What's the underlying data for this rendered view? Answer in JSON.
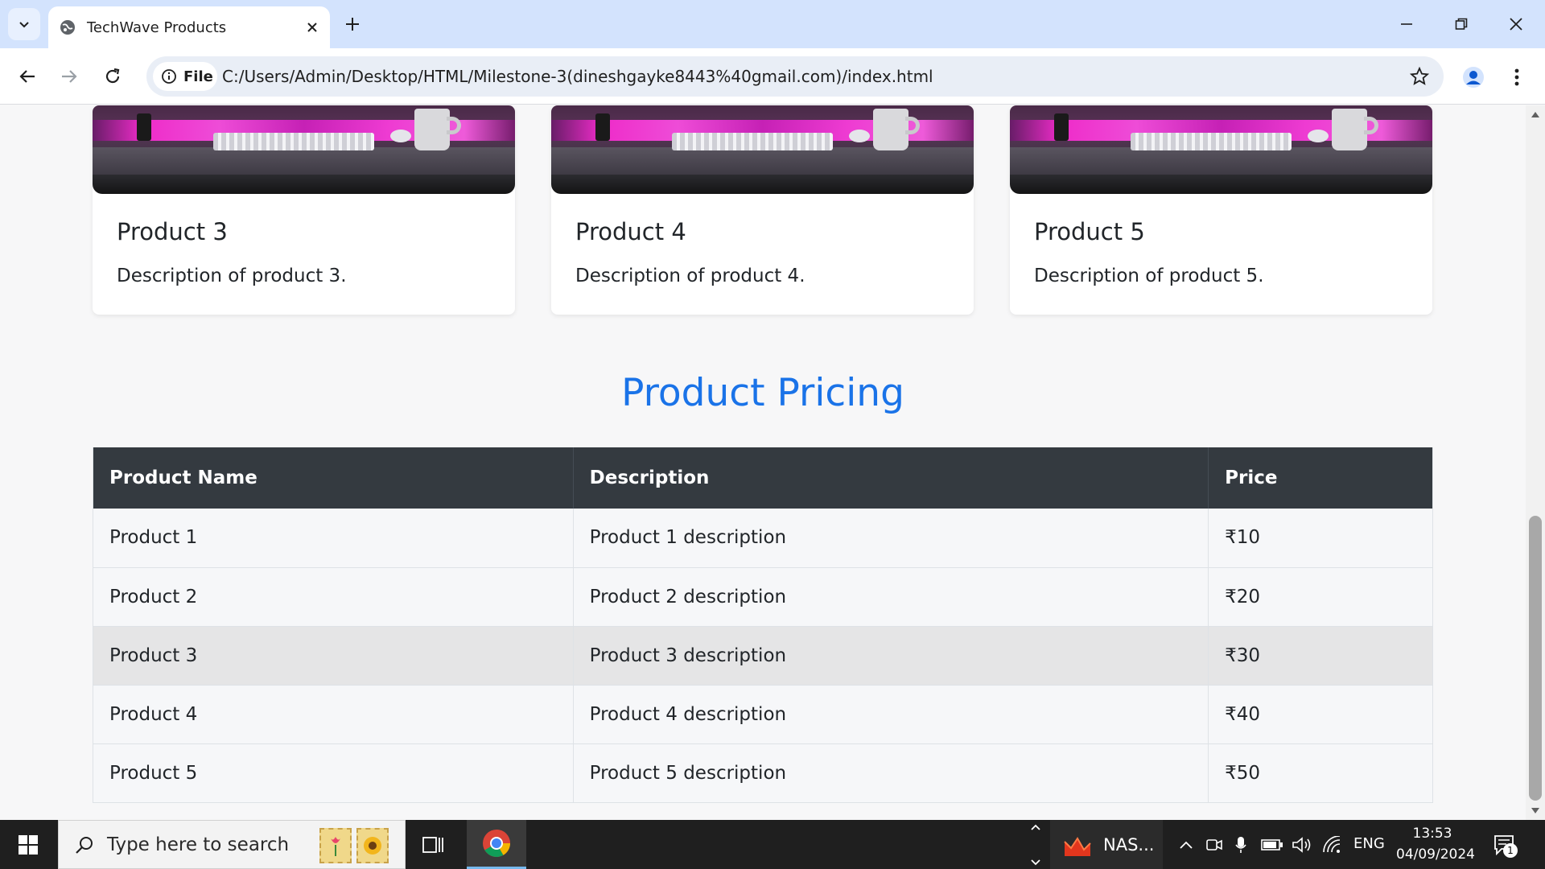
{
  "browser": {
    "tab_title": "TechWave Products",
    "file_chip_label": "File",
    "url": "C:/Users/Admin/Desktop/HTML/Milestone-3(dineshgayke8443%40gmail.com)/index.html"
  },
  "page": {
    "cards": [
      {
        "title": "Product 3",
        "description": "Description of product 3."
      },
      {
        "title": "Product 4",
        "description": "Description of product 4."
      },
      {
        "title": "Product 5",
        "description": "Description of product 5."
      }
    ],
    "pricing_title": "Product Pricing",
    "table": {
      "headers": [
        "Product Name",
        "Description",
        "Price"
      ],
      "rows": [
        [
          "Product 1",
          "Product 1 description",
          "₹10"
        ],
        [
          "Product 2",
          "Product 2 description",
          "₹20"
        ],
        [
          "Product 3",
          "Product 3 description",
          "₹30"
        ],
        [
          "Product 4",
          "Product 4 description",
          "₹40"
        ],
        [
          "Product 5",
          "Product 5 description",
          "₹50"
        ]
      ],
      "hovered_row": 2
    }
  },
  "taskbar": {
    "search_placeholder": "Type here to search",
    "nas_label": "NAS...",
    "language": "ENG",
    "time": "13:53",
    "date": "04/09/2024",
    "notification_count": "1"
  },
  "colors": {
    "accent": "#1a73e8",
    "table_header": "#343a40",
    "tabbar": "#d3e3fd"
  }
}
